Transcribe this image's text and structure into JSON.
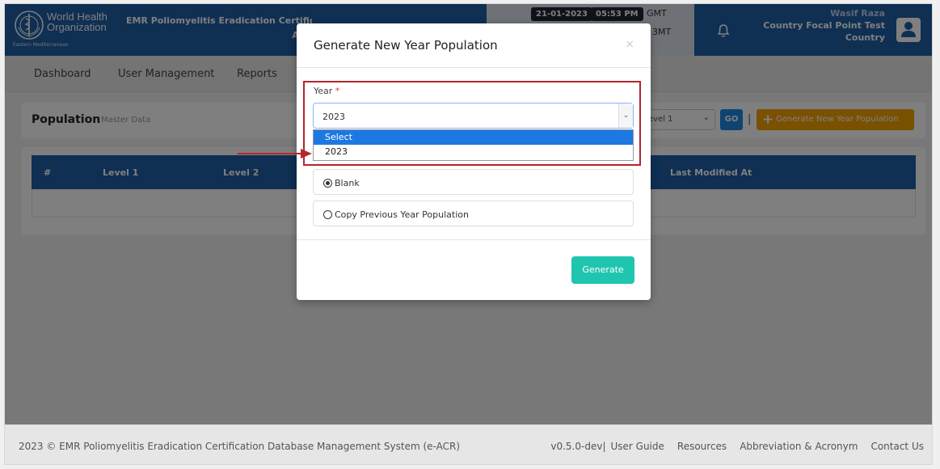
{
  "header": {
    "org_line1": "World Health",
    "org_line2": "Organization",
    "org_line3": "Eastern Mediterranean",
    "app_title_line1": "EMR Poliomyelitis Eradication Certificat",
    "app_title_line2": "AC",
    "date": "21-01-2023",
    "time": "05:53 PM",
    "tz1": "GMT",
    "tz2": "3MT",
    "user": {
      "name": "Wasif Raza",
      "role": "Country Focal Point Test",
      "level": "Country"
    }
  },
  "nav": {
    "items": [
      {
        "label": "Dashboard"
      },
      {
        "label": "User Management"
      },
      {
        "label": "Reports"
      }
    ]
  },
  "page": {
    "title": "Population",
    "subtitle": "Master Data",
    "level_select_value": "evel 1",
    "go_label": "GO",
    "separator": "|",
    "generate_label": "Generate New Year Population"
  },
  "table": {
    "columns": [
      "#",
      "Level 1",
      "Level 2",
      "Last Modified At"
    ]
  },
  "modal": {
    "title": "Generate New Year Population",
    "close": "×",
    "year_label": "Year",
    "required_mark": "*",
    "year_value": "2023",
    "dropdown_options": [
      "Select",
      "2023"
    ],
    "radio_blank": "Blank",
    "radio_copy": "Copy Previous Year Population",
    "generate_label": "Generate"
  },
  "footer": {
    "copyright": "2023 ©  EMR Poliomyelitis Eradication Certification Database Management System (e-ACR)",
    "version": "v0.5.0-dev",
    "pipe": "|",
    "user_guide": "User Guide",
    "resources": "Resources",
    "abbreviation": "Abbreviation & Acronym",
    "contact": "Contact Us"
  },
  "colors": {
    "primary": "#1f5fa6",
    "accent_orange": "#f5a300",
    "go_blue": "#1e88e5",
    "generate_teal": "#20c5b0",
    "highlight_red": "#b5252a"
  }
}
